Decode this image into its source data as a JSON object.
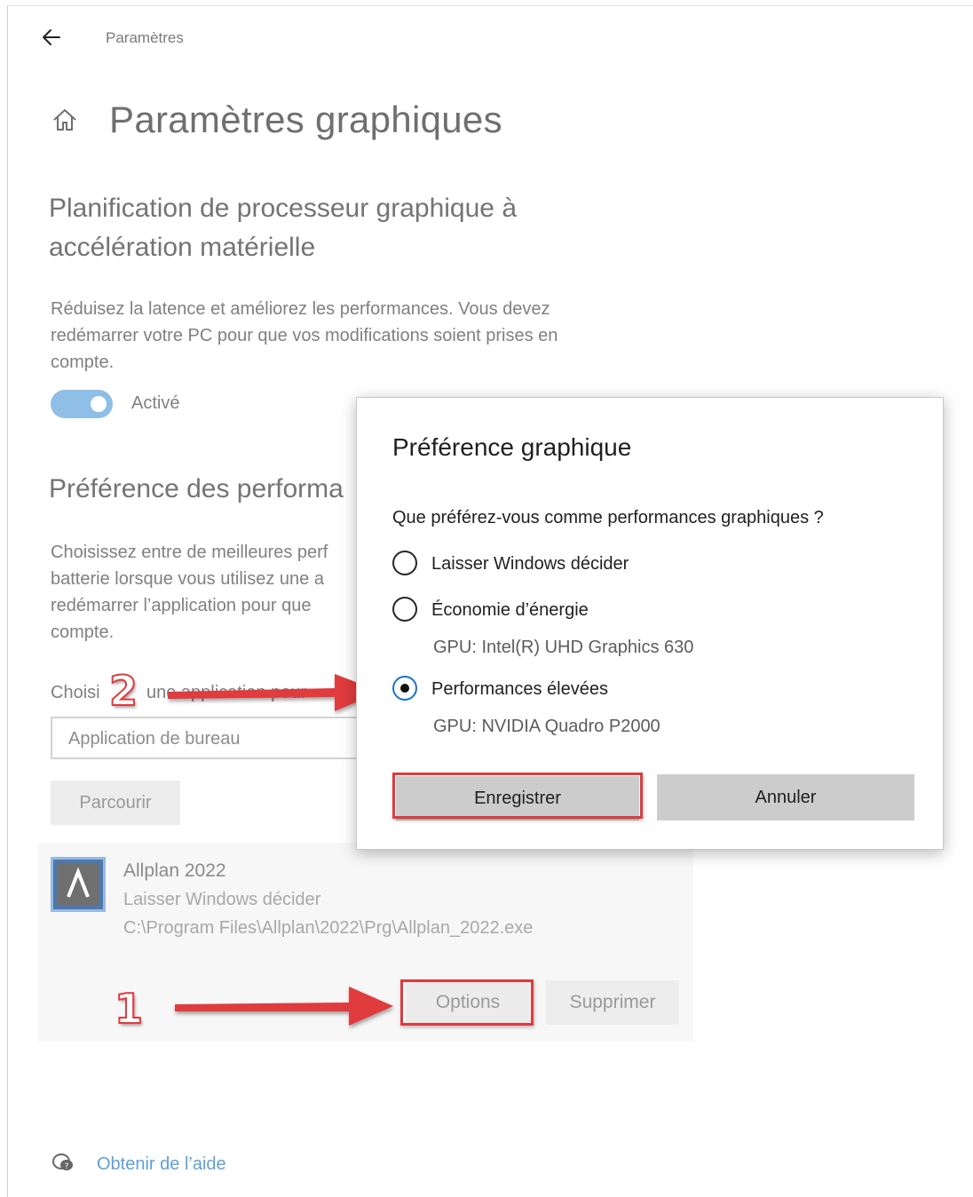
{
  "header": {
    "app_title": "Paramètres",
    "page_title": "Paramètres graphiques"
  },
  "hardware_scheduling": {
    "title_line1": "Planification de processeur graphique à",
    "title_line2": "accélération matérielle",
    "desc_line1": "Réduisez la latence et améliorez les performances. Vous devez",
    "desc_line2": "redémarrer votre PC pour que vos modifications soient prises en",
    "desc_line3": "compte.",
    "toggle_label": "Activé",
    "toggle_on": true
  },
  "performance_pref": {
    "title": "Préférence des performa",
    "desc_line1": "Choisissez entre de meilleures perf",
    "desc_line2": "batterie lorsque vous utilisez une a",
    "desc_line3": "redémarrer l’application pour que",
    "desc_line4": "compte.",
    "choose_label": "Choisi",
    "choose_label_tail": "une application pour",
    "select_value": "Application de bureau",
    "browse_label": "Parcourir"
  },
  "app_entry": {
    "name": "Allplan 2022",
    "preference": "Laisser Windows décider",
    "path": "C:\\Program Files\\Allplan\\2022\\Prg\\Allplan_2022.exe",
    "options_label": "Options",
    "delete_label": "Supprimer"
  },
  "help": {
    "link_label": "Obtenir de l’aide"
  },
  "dialog": {
    "title": "Préférence graphique",
    "question": "Que préférez-vous comme performances graphiques ?",
    "options": [
      {
        "label": "Laisser Windows décider",
        "sub": "",
        "selected": false
      },
      {
        "label": "Économie d’énergie",
        "sub": "GPU: Intel(R) UHD Graphics 630",
        "selected": false
      },
      {
        "label": "Performances élevées",
        "sub": "GPU: NVIDIA Quadro P2000",
        "selected": true
      }
    ],
    "save_label": "Enregistrer",
    "cancel_label": "Annuler"
  },
  "annotations": {
    "step1": "1",
    "step2": "2",
    "color": "#e03a3e"
  },
  "icons": [
    "back-arrow-icon",
    "home-icon",
    "app-icon",
    "help-chat-icon"
  ]
}
